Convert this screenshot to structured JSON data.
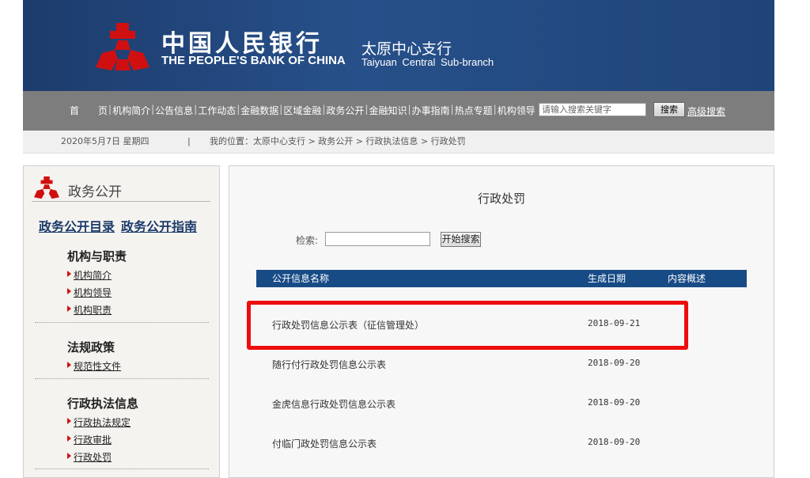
{
  "header": {
    "logo_cn": "中国人民银行",
    "logo_en": "THE PEOPLE'S BANK OF CHINA",
    "branch_cn": "太原中心支行",
    "branch_en": "Taiyuan Central Sub-branch"
  },
  "nav": {
    "items": [
      "首　　页",
      "机构简介",
      "公告信息",
      "工作动态",
      "金融数据",
      "区域金融",
      "政务公开",
      "金融知识",
      "办事指南",
      "热点专题",
      "机构领导"
    ],
    "search_placeholder": "请输入搜索关键字",
    "search_button": "搜索",
    "advanced_search": "高级搜索"
  },
  "breadcrumb": {
    "date": "2020年5月7日 星期四",
    "separator": "|",
    "path": "我的位置：太原中心支行  >  政务公开  >  行政执法信息  >  行政处罚"
  },
  "sidebar": {
    "title": "政务公开",
    "link_catalog": "政务公开目录",
    "link_guide": "政务公开指南",
    "sections": [
      {
        "title": "机构与职责",
        "items": [
          "机构简介",
          "机构领导",
          "机构职责"
        ]
      },
      {
        "title": "法规政策",
        "items": [
          "规范性文件"
        ]
      },
      {
        "title": "行政执法信息",
        "items": [
          "行政执法规定",
          "行政审批",
          "行政处罚"
        ]
      }
    ]
  },
  "main": {
    "title": "行政处罚",
    "search_label": "检索:",
    "search_value": "",
    "search_button": "开始搜索",
    "columns": {
      "name": "公开信息名称",
      "date": "生成日期",
      "summary": "内容概述"
    },
    "rows": [
      {
        "name": "行政处罚信息公示表（征信管理处）",
        "date": "2018-09-21",
        "summary": ""
      },
      {
        "name": "随行付行政处罚信息公示表",
        "date": "2018-09-20",
        "summary": ""
      },
      {
        "name": "金虎信息行政处罚信息公示表",
        "date": "2018-09-20",
        "summary": ""
      },
      {
        "name": "付临门政处罚信息公示表",
        "date": "2018-09-20",
        "summary": ""
      }
    ]
  },
  "colors": {
    "banner": "#1f4478",
    "nav": "#7d7d7d",
    "table_header": "#174b86",
    "highlight": "#ee0d0d",
    "emblem": "#d01010"
  }
}
